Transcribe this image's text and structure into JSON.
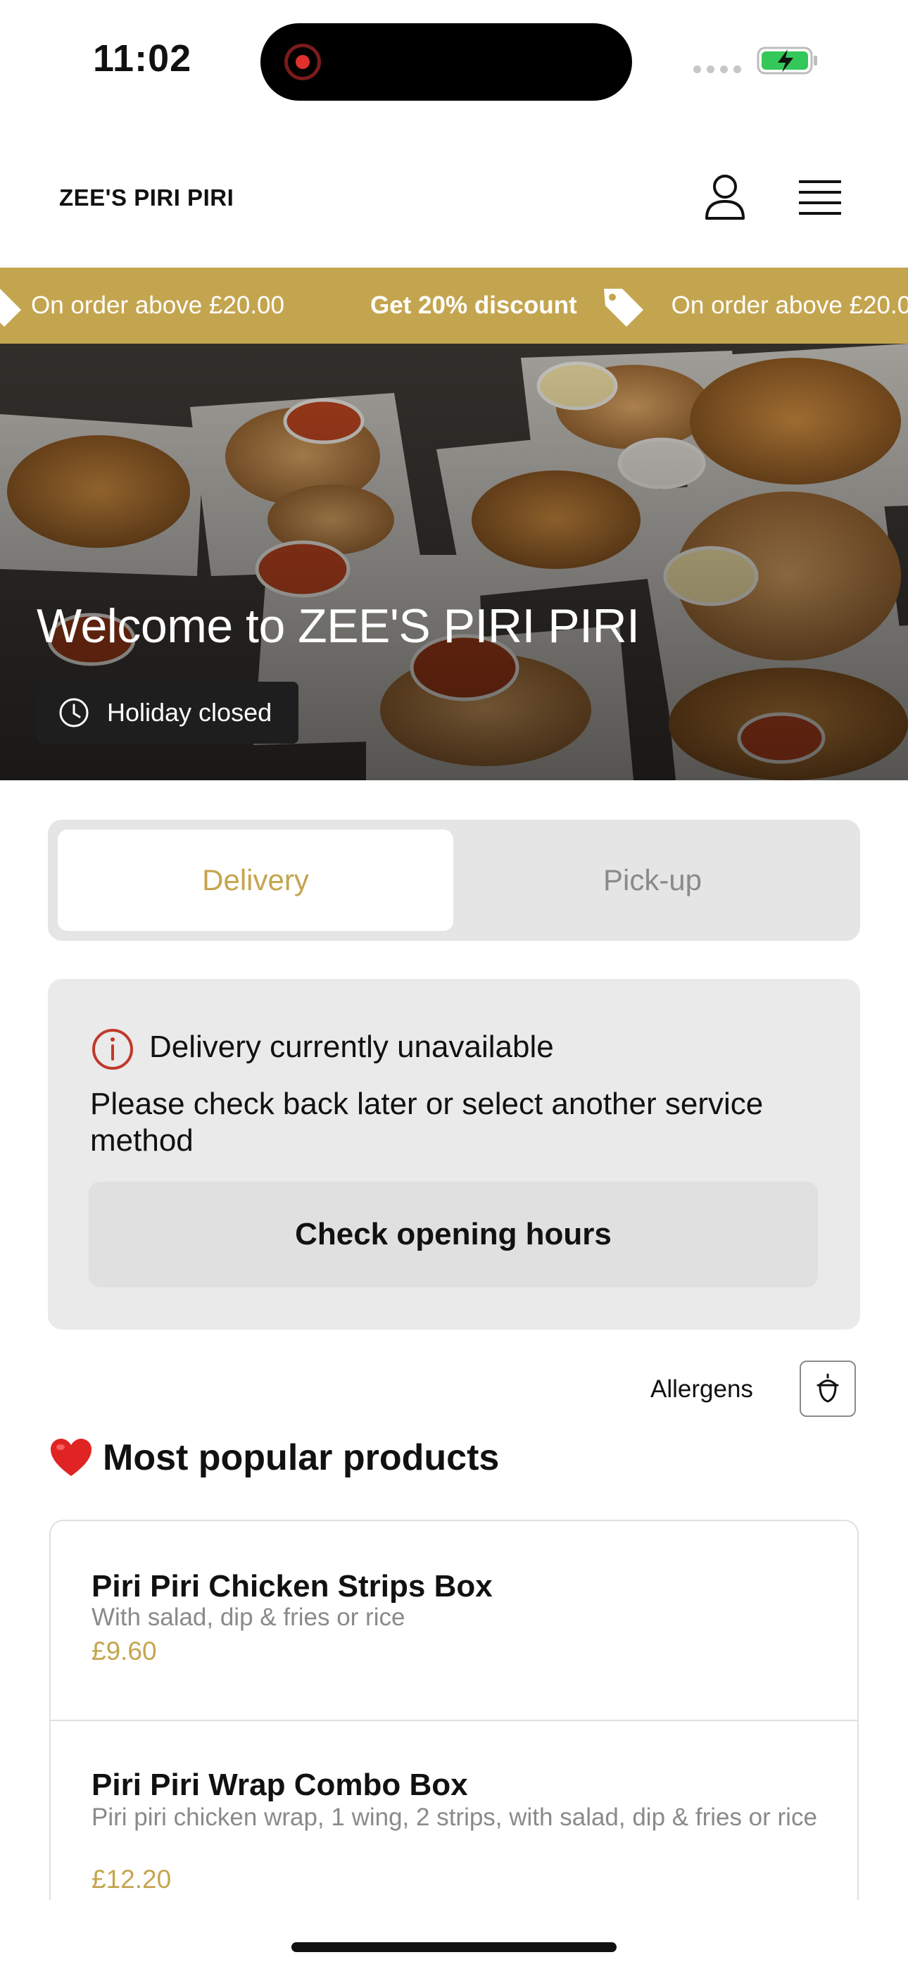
{
  "status_bar": {
    "time": "11:02"
  },
  "header": {
    "brand": "ZEE'S PIRI PIRI"
  },
  "promo": {
    "items": [
      "On order above £20.00",
      "Get 20% discount",
      "On order above £20.00"
    ]
  },
  "hero": {
    "title": "Welcome to ZEE'S PIRI PIRI",
    "status": "Holiday closed"
  },
  "service_toggle": {
    "delivery": "Delivery",
    "pickup": "Pick-up",
    "selected": "Delivery"
  },
  "notice": {
    "title": "Delivery currently unavailable",
    "body": "Please check back later or select another service method",
    "button": "Check opening hours"
  },
  "allergens": {
    "label": "Allergens"
  },
  "popular": {
    "title": "Most popular products",
    "products": [
      {
        "name": " Piri Piri Chicken Strips Box",
        "description": "With salad, dip & fries or rice",
        "price": "£9.60"
      },
      {
        "name": "Piri Piri Wrap Combo Box",
        "description": "Piri piri chicken wrap, 1 wing, 2 strips, with salad, dip & fries or rice",
        "price": "£12.20"
      }
    ]
  },
  "colors": {
    "accent": "#c4a54f",
    "battery": "#34c759",
    "alert": "#c0392b"
  }
}
